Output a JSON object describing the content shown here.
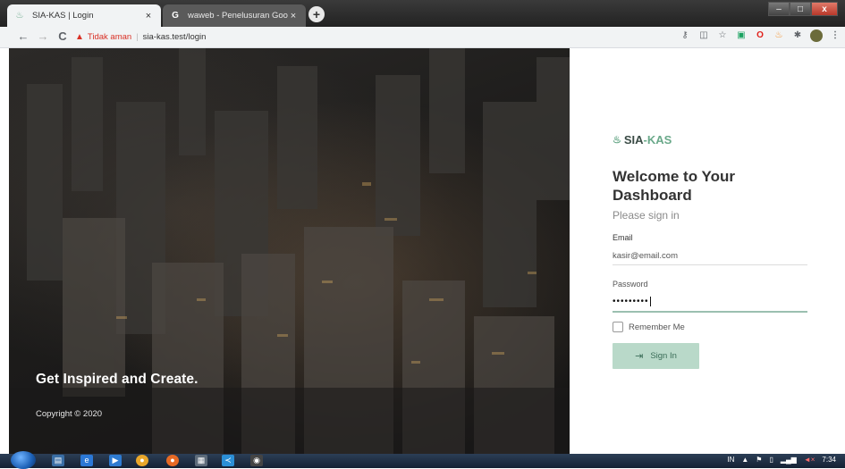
{
  "browser": {
    "tabs": [
      {
        "title": "SIA-KAS | Login",
        "favicon": "flame-icon",
        "active": true
      },
      {
        "title": "waweb - Penelusuran Google",
        "favicon": "google-icon",
        "active": false
      }
    ],
    "new_tab_label": "+",
    "window_controls": {
      "minimize": "–",
      "maximize": "□",
      "close": "x"
    },
    "nav": {
      "back": "←",
      "forward": "→",
      "reload": "C"
    },
    "address": {
      "security_label": "Tidak aman",
      "url": "sia-kas.test/login"
    },
    "extensions": [
      "key-icon",
      "translate-icon",
      "star-icon",
      "cast-icon",
      "opera-icon",
      "honey-icon",
      "puzzle-icon",
      "avatar-icon",
      "menu-icon"
    ]
  },
  "hero": {
    "tagline": "Get Inspired and Create.",
    "copyright": "Copyright © 2020"
  },
  "login": {
    "brand_part1": "SIA",
    "brand_dash": "-",
    "brand_part2": "KAS",
    "heading": "Welcome to Your Dashboard",
    "subtitle": "Please sign in",
    "email_label": "Email",
    "email_value": "kasir@email.com",
    "password_label": "Password",
    "password_value": "•••••••••",
    "remember_label": "Remember Me",
    "remember_checked": false,
    "signin_label": "Sign In"
  },
  "taskbar": {
    "language": "IN",
    "time": "7:34"
  },
  "colors": {
    "accent": "#6aa98a",
    "button_bg": "#b9d9c9",
    "button_text": "#3b6d58",
    "security_warning": "#d93025"
  }
}
